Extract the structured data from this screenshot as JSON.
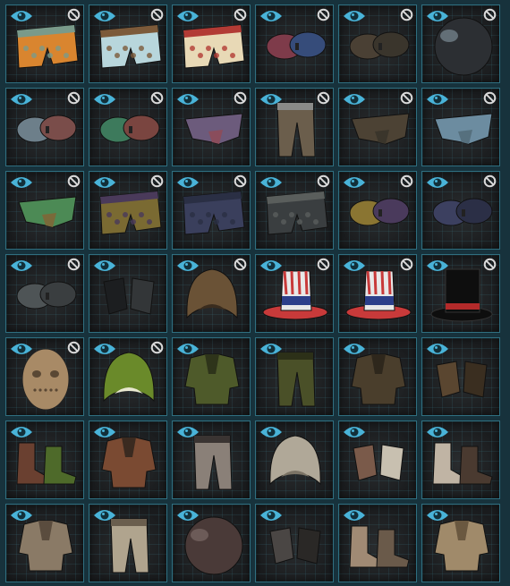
{
  "screen": "cosmetic-skin-inventory",
  "colors": {
    "eye_icon": "#49b3d8",
    "ban_icon": "#d9d9d9",
    "slot_border": "#2f6f80",
    "slot_background": "#1b1d1f"
  },
  "slots": [
    {
      "item": "boxers-pink-pattern-skin",
      "colors": [
        "#d9852f",
        "#7a9a8a"
      ],
      "hidden_badge": true
    },
    {
      "item": "boxers-blue-pattern-skin",
      "colors": [
        "#b8d6dc",
        "#7c5a3a"
      ],
      "hidden_badge": true
    },
    {
      "item": "boxers-cake-pattern-skin",
      "colors": [
        "#e8d9b6",
        "#b23b35"
      ],
      "hidden_badge": true
    },
    {
      "item": "bra-red-blue-skin",
      "colors": [
        "#7e3b4a",
        "#364c7a"
      ],
      "hidden_badge": true
    },
    {
      "item": "bra-camo-skin",
      "colors": [
        "#4a4034",
        "#3a352c"
      ],
      "hidden_badge": true
    },
    {
      "item": "chrome-helmet-skin",
      "colors": [
        "#2c2f33",
        "#7a8a94"
      ],
      "hidden_badge": true
    },
    {
      "item": "bra-grey-red-skin",
      "colors": [
        "#6d7f8a",
        "#7a4d4a"
      ],
      "hidden_badge": true
    },
    {
      "item": "bra-green-red-skin",
      "colors": [
        "#3d7a5c",
        "#7a4540"
      ],
      "hidden_badge": true
    },
    {
      "item": "panties-pink-blue-skin",
      "colors": [
        "#6c5b7c",
        "#8a4d5c"
      ],
      "hidden_badge": true
    },
    {
      "item": "cargo-pants-skin",
      "colors": [
        "#6b5e4c",
        "#8a8a88"
      ],
      "hidden_badge": true
    },
    {
      "item": "panties-camo-skin",
      "colors": [
        "#4c4234",
        "#3a352b"
      ],
      "hidden_badge": true
    },
    {
      "item": "panties-light-blue-skin",
      "colors": [
        "#6c8ca0",
        "#56707e"
      ],
      "hidden_badge": true
    },
    {
      "item": "panties-green-skin",
      "colors": [
        "#4c8a55",
        "#7a6a3a"
      ],
      "hidden_badge": true
    },
    {
      "item": "boxers-yellow-purple-skin",
      "colors": [
        "#7a6a32",
        "#4a3a5a"
      ],
      "hidden_badge": true
    },
    {
      "item": "boxers-navy-skin",
      "colors": [
        "#3a3f5c",
        "#2a2f44"
      ],
      "hidden_badge": true
    },
    {
      "item": "boxers-dotted-grey-skin",
      "colors": [
        "#3a3e40",
        "#5a5e5c"
      ],
      "hidden_badge": true
    },
    {
      "item": "bra-yellow-purple-skin",
      "colors": [
        "#8a7532",
        "#4a3a5c"
      ],
      "hidden_badge": true
    },
    {
      "item": "bra-navy-skin",
      "colors": [
        "#3c4060",
        "#2b2f46"
      ],
      "hidden_badge": true
    },
    {
      "item": "bra-dotted-grey-skin",
      "colors": [
        "#4e5456",
        "#3a3e40"
      ],
      "hidden_badge": true
    },
    {
      "item": "black-gloves-skin",
      "colors": [
        "#1c1e20",
        "#333638"
      ],
      "hidden_badge": false
    },
    {
      "item": "wolf-hood-skin",
      "colors": [
        "#6a5236",
        "#3a2c1e"
      ],
      "hidden_badge": true
    },
    {
      "item": "uncle-sam-hat-skin",
      "colors": [
        "#c83a3a",
        "#2c3f8a"
      ],
      "hidden_badge": true
    },
    {
      "item": "uncle-sam-hat-skin",
      "colors": [
        "#c83a3a",
        "#2c3f8a"
      ],
      "hidden_badge": true
    },
    {
      "item": "top-hat-skin",
      "colors": [
        "#0e0e0e",
        "#b32a2a"
      ],
      "hidden_badge": true
    },
    {
      "item": "hockey-mask-skin",
      "colors": [
        "#a88a66",
        "#5a4834"
      ],
      "hidden_badge": true
    },
    {
      "item": "monster-hood-skin",
      "colors": [
        "#6a8a2a",
        "#e8e8d0"
      ],
      "hidden_badge": true
    },
    {
      "item": "ghillie-chest-skin",
      "colors": [
        "#4e5a2a",
        "#2e341a"
      ],
      "hidden_badge": false
    },
    {
      "item": "ghillie-pants-skin",
      "colors": [
        "#4a5028",
        "#2c3018"
      ],
      "hidden_badge": false
    },
    {
      "item": "ghillie-shirt-skin",
      "colors": [
        "#4a3e2c",
        "#2e271c"
      ],
      "hidden_badge": false
    },
    {
      "item": "ghillie-gloves-skin",
      "colors": [
        "#5a4630",
        "#3a2e20"
      ],
      "hidden_badge": false
    },
    {
      "item": "ghillie-boots-skin",
      "colors": [
        "#6a4030",
        "#4e6a2a"
      ],
      "hidden_badge": false
    },
    {
      "item": "leather-chest-skin",
      "colors": [
        "#7a4a32",
        "#3a2a20"
      ],
      "hidden_badge": false
    },
    {
      "item": "leather-pants-skin",
      "colors": [
        "#8a8078",
        "#3a3432"
      ],
      "hidden_badge": false
    },
    {
      "item": "fur-hood-skin",
      "colors": [
        "#b0a898",
        "#7c7466"
      ],
      "hidden_badge": false
    },
    {
      "item": "fur-gloves-skin",
      "colors": [
        "#7a5a4a",
        "#c8c0b0"
      ],
      "hidden_badge": false
    },
    {
      "item": "fur-boots-skin",
      "colors": [
        "#c0b4a4",
        "#4a3a30"
      ],
      "hidden_badge": false
    },
    {
      "item": "hide-chest-skin",
      "colors": [
        "#8a7a66",
        "#5a4c3e"
      ],
      "hidden_badge": false
    },
    {
      "item": "hide-pants-skin",
      "colors": [
        "#b0a48e",
        "#6a5e4e"
      ],
      "hidden_badge": false
    },
    {
      "item": "hide-helmet-skin",
      "colors": [
        "#4a3a38",
        "#7a6a66"
      ],
      "hidden_badge": false
    },
    {
      "item": "hide-gloves-skin",
      "colors": [
        "#4a4644",
        "#2a2826"
      ],
      "hidden_badge": false
    },
    {
      "item": "hide-boots-skin",
      "colors": [
        "#a08a74",
        "#6a5a4a"
      ],
      "hidden_badge": false
    },
    {
      "item": "hide-shirt-skin",
      "colors": [
        "#a08a6a",
        "#6a5840"
      ],
      "hidden_badge": false
    }
  ]
}
